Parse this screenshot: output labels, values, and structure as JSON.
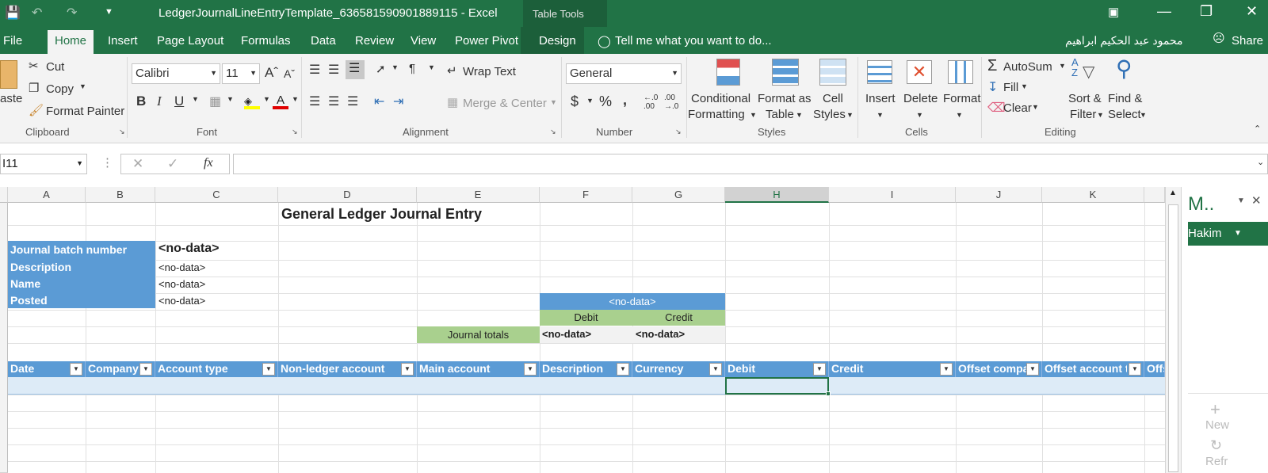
{
  "window": {
    "title": "LedgerJournalLineEntryTemplate_636581590901889115 - Excel",
    "table_tools": "Table Tools"
  },
  "tabs": [
    "File",
    "Home",
    "Insert",
    "Page Layout",
    "Formulas",
    "Data",
    "Review",
    "View",
    "Power Pivot",
    "Design"
  ],
  "tell_me": "Tell me what you want to do...",
  "user_name": "محمود عبد الحكيم ابراهيم",
  "share": "Share",
  "ribbon": {
    "clipboard": {
      "paste": "aste",
      "cut": "Cut",
      "copy": "Copy",
      "format_painter": "Format Painter",
      "label": "Clipboard"
    },
    "font": {
      "name": "Calibri",
      "size": "11",
      "label": "Font"
    },
    "alignment": {
      "wrap_text": "Wrap Text",
      "merge_center": "Merge & Center",
      "label": "Alignment"
    },
    "number": {
      "format": "General",
      "label": "Number"
    },
    "styles": {
      "conditional": "Conditional",
      "formatting": "Formatting",
      "format_as": "Format as",
      "table": "Table",
      "cell": "Cell",
      "styles_btn": "Styles",
      "label": "Styles"
    },
    "cells": {
      "insert": "Insert",
      "delete": "Delete",
      "format": "Format",
      "label": "Cells"
    },
    "editing": {
      "autosum": "AutoSum",
      "fill": "Fill",
      "clear": "Clear",
      "sort": "Sort &",
      "filter": "Filter",
      "find": "Find &",
      "select": "Select",
      "label": "Editing"
    }
  },
  "formula_bar": {
    "name_box": "I11",
    "fx": "fx",
    "value": ""
  },
  "columns": [
    "A",
    "B",
    "C",
    "D",
    "E",
    "F",
    "G",
    "H",
    "I",
    "J",
    "K"
  ],
  "sheet": {
    "title": "General Ledger Journal Entry",
    "labels": [
      "Journal batch number",
      "Description",
      "Name",
      "Posted"
    ],
    "values": [
      "<no-data>",
      "<no-data>",
      "<no-data>",
      "<no-data>"
    ],
    "summary_header": "<no-data>",
    "debit": "Debit",
    "credit": "Credit",
    "journal_totals": "Journal totals",
    "total_debit": "<no-data>",
    "total_credit": "<no-data>",
    "table_headers": [
      "Date",
      "Company",
      "Account type",
      "Non-ledger account",
      "Main account",
      "Description",
      "Currency",
      "Debit",
      "Credit",
      "Offset company",
      "Offset account type",
      "Offset"
    ]
  },
  "pane": {
    "title": "M..",
    "user": "Hakim",
    "new": "New",
    "refresh": "Refr"
  },
  "colors": {
    "excel_green": "#217346",
    "table_blue": "#5b9bd5",
    "total_green": "#a9d08e",
    "row_band": "#ddebf7"
  }
}
